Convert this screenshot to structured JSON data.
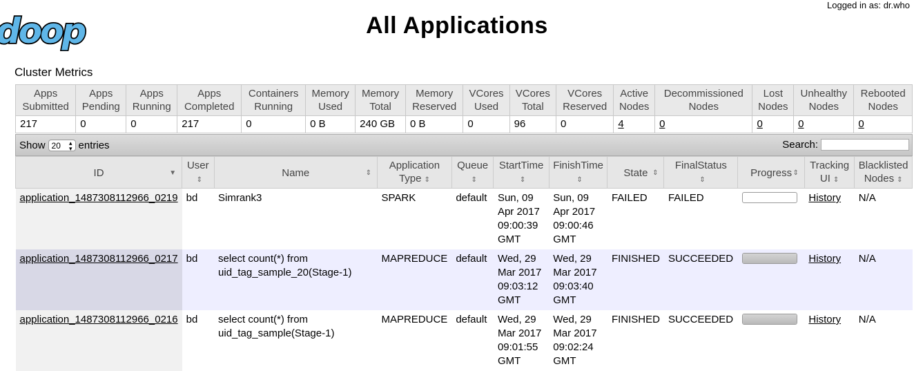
{
  "logo": {
    "text": "doop"
  },
  "header": {
    "login_text": "Logged in as: dr.who",
    "title": "All Applications"
  },
  "cluster_metrics": {
    "title": "Cluster Metrics",
    "columns": [
      [
        "Apps",
        "Submitted"
      ],
      [
        "Apps",
        "Pending"
      ],
      [
        "Apps",
        "Running"
      ],
      [
        "Apps",
        "Completed"
      ],
      [
        "Containers",
        "Running"
      ],
      [
        "Memory",
        "Used"
      ],
      [
        "Memory",
        "Total"
      ],
      [
        "Memory",
        "Reserved"
      ],
      [
        "VCores",
        "Used"
      ],
      [
        "VCores",
        "Total"
      ],
      [
        "VCores",
        "Reserved"
      ],
      [
        "Active",
        "Nodes"
      ],
      [
        "Decommissioned",
        "Nodes"
      ],
      [
        "Lost",
        "Nodes"
      ],
      [
        "Unhealthy",
        "Nodes"
      ],
      [
        "Rebooted",
        "Nodes"
      ]
    ],
    "values": [
      "217",
      "0",
      "0",
      "217",
      "0",
      "0 B",
      "240 GB",
      "0 B",
      "0",
      "96",
      "0",
      "4",
      "0",
      "0",
      "0",
      "0"
    ]
  },
  "table_controls": {
    "show_label": "Show",
    "entries_value": "20",
    "entries_label": "entries",
    "search_label": "Search:",
    "search_value": ""
  },
  "apps_table": {
    "columns": {
      "id": "ID",
      "user": "User",
      "name": "Name",
      "app_type": "Application Type",
      "queue": "Queue",
      "start_time": "StartTime",
      "finish_time": "FinishTime",
      "state": "State",
      "final_status": "FinalStatus",
      "progress": "Progress",
      "tracking_ui": "Tracking UI",
      "blacklisted": "Blacklisted Nodes"
    },
    "rows": [
      {
        "id": "application_1487308112966_0219",
        "user": "bd",
        "name": "Simrank3",
        "type": "SPARK",
        "queue": "default",
        "start": "Sun, 09 Apr 2017 09:00:39 GMT",
        "finish": "Sun, 09 Apr 2017 09:00:46 GMT",
        "state": "FAILED",
        "final_status": "FAILED",
        "progress": 0,
        "tracking": "History",
        "blacklisted": "N/A"
      },
      {
        "id": "application_1487308112966_0217",
        "user": "bd",
        "name": "select count(*) from uid_tag_sample_20(Stage-1)",
        "type": "MAPREDUCE",
        "queue": "default",
        "start": "Wed, 29 Mar 2017 09:03:12 GMT",
        "finish": "Wed, 29 Mar 2017 09:03:40 GMT",
        "state": "FINISHED",
        "final_status": "SUCCEEDED",
        "progress": 1,
        "tracking": "History",
        "blacklisted": "N/A"
      },
      {
        "id": "application_1487308112966_0216",
        "user": "bd",
        "name": "select count(*) from uid_tag_sample(Stage-1)",
        "type": "MAPREDUCE",
        "queue": "default",
        "start": "Wed, 29 Mar 2017 09:01:55 GMT",
        "finish": "Wed, 29 Mar 2017 09:02:24 GMT",
        "state": "FINISHED",
        "final_status": "SUCCEEDED",
        "progress": 1,
        "tracking": "History",
        "blacklisted": "N/A"
      }
    ]
  }
}
